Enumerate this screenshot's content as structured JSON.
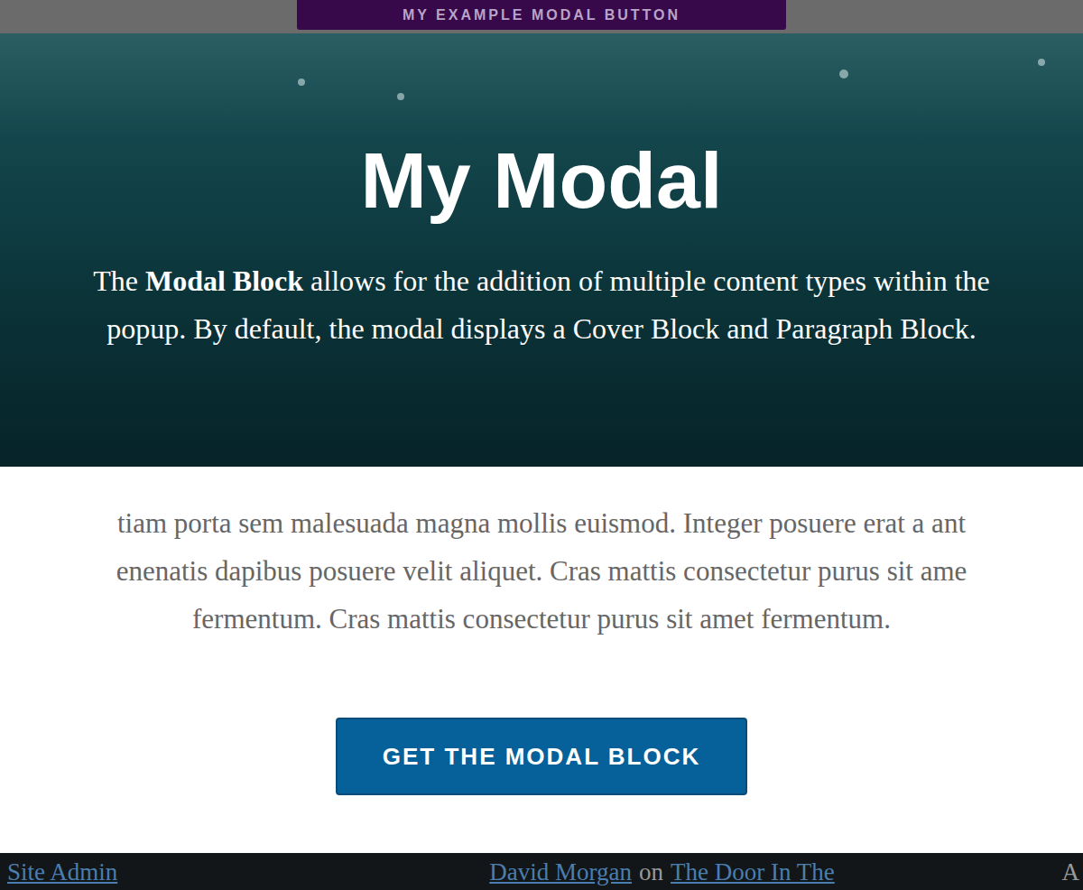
{
  "page_button": {
    "label": "MY EXAMPLE MODAL BUTTON"
  },
  "modal": {
    "cover": {
      "title": "My Modal",
      "lines": [
        [
          {
            "text": "The ",
            "bold": false
          },
          {
            "text": "Modal Block",
            "bold": true
          },
          {
            "text": " allows for the addition of multiple content types within the",
            "bold": false
          }
        ],
        [
          {
            "text": "popup. By default, the modal displays a Cover Block and Paragraph Block.",
            "bold": false
          }
        ]
      ]
    },
    "paragraph_lines": [
      "tiam porta sem malesuada magna mollis euismod. Integer posuere erat a ant",
      "enenatis dapibus posuere velit aliquet. Cras mattis consectetur purus sit ame",
      "fermentum. Cras mattis consectetur purus sit amet fermentum."
    ],
    "button": {
      "label": "GET THE MODAL BLOCK"
    }
  },
  "footer": {
    "admin_link": "Site Admin",
    "comment": {
      "author": "David Morgan",
      "joiner": "on",
      "post": "The Door In The"
    },
    "edge_text": "A"
  }
}
